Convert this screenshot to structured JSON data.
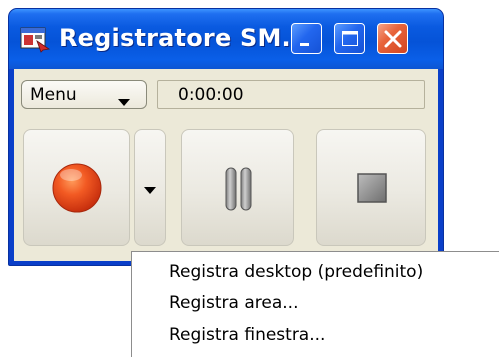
{
  "window": {
    "title": "Registratore SM...",
    "app_icon": "recorder-app-icon",
    "controls": {
      "minimize": "minimize-icon",
      "maximize": "maximize-icon",
      "close": "close-icon"
    }
  },
  "toolbar": {
    "menu_label": "Menu",
    "time": "0:00:00"
  },
  "buttons": {
    "record": "record-icon",
    "record_options": "caret-down-icon",
    "pause": "pause-icon",
    "stop": "stop-icon"
  },
  "context_menu": {
    "items": [
      "Registra desktop (predefinito)",
      "Registra area...",
      "Registra finestra..."
    ]
  },
  "colors": {
    "titlebar": "#0553d8",
    "client": "#ece9d8",
    "record_red": "#e8421c",
    "close_red": "#e8643b"
  }
}
